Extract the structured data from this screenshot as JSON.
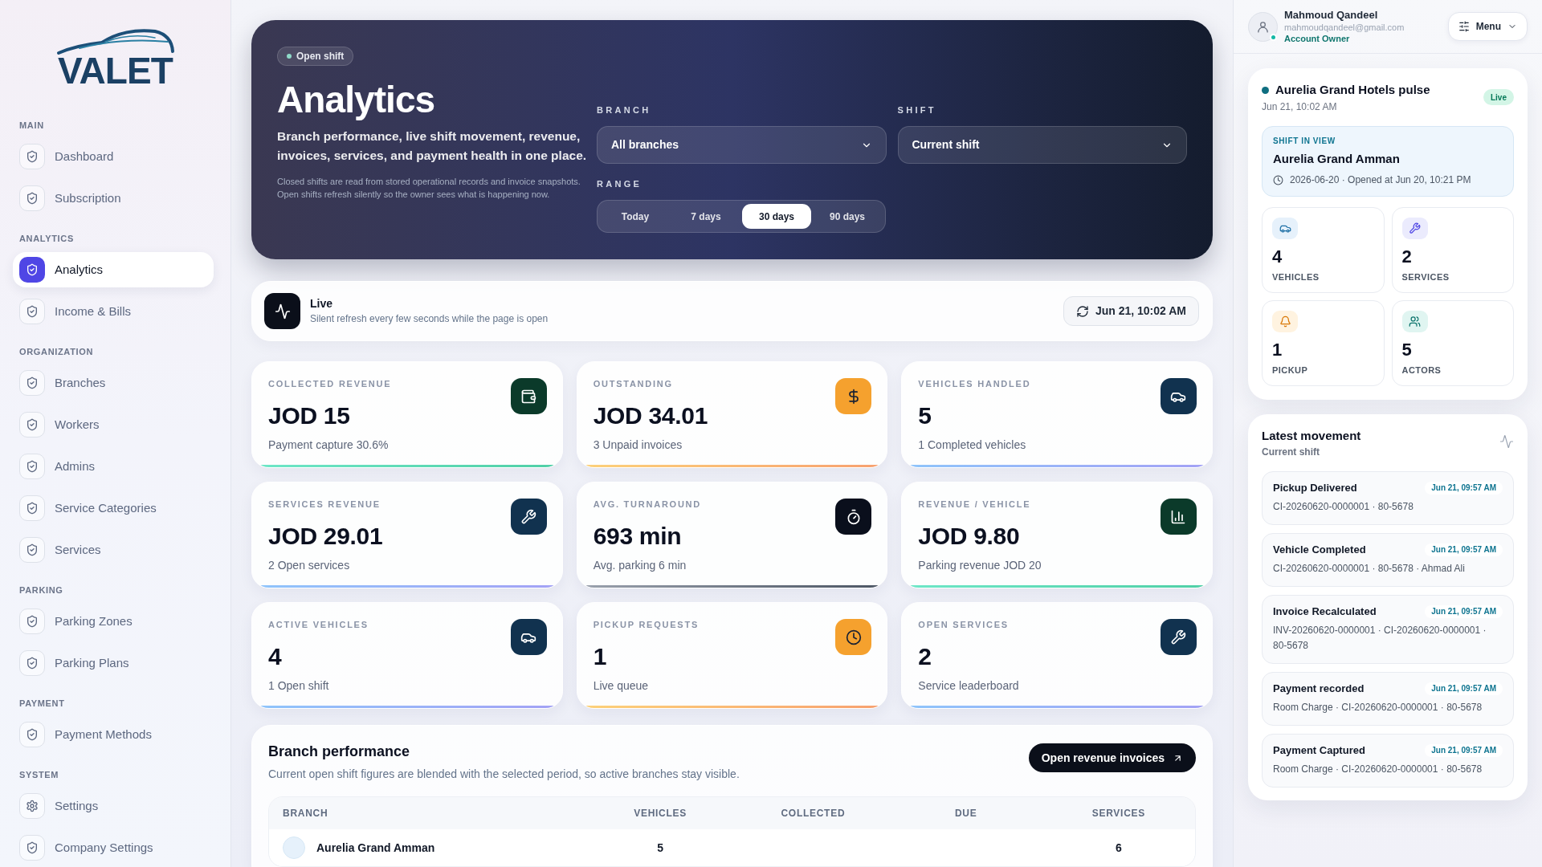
{
  "sidebar": {
    "logo": "VALET",
    "sections": [
      {
        "title": "MAIN",
        "items": [
          {
            "label": "Dashboard",
            "kind": "page",
            "selected": false
          },
          {
            "label": "Subscription",
            "kind": "page",
            "selected": false
          }
        ]
      },
      {
        "title": "ANALYTICS",
        "items": [
          {
            "label": "Analytics",
            "kind": "page",
            "selected": true
          },
          {
            "label": "Income & Bills",
            "kind": "page",
            "selected": false
          }
        ]
      },
      {
        "title": "ORGANIZATION",
        "items": [
          {
            "label": "Branches",
            "kind": "page",
            "selected": false
          },
          {
            "label": "Workers",
            "kind": "page",
            "selected": false
          },
          {
            "label": "Admins",
            "kind": "page",
            "selected": false
          },
          {
            "label": "Service Categories",
            "kind": "page",
            "selected": false
          },
          {
            "label": "Services",
            "kind": "page",
            "selected": false
          }
        ]
      },
      {
        "title": "PARKING",
        "items": [
          {
            "label": "Parking Zones",
            "kind": "page",
            "selected": false
          },
          {
            "label": "Parking Plans",
            "kind": "page",
            "selected": false
          }
        ]
      },
      {
        "title": "PAYMENT",
        "items": [
          {
            "label": "Payment Methods",
            "kind": "page",
            "selected": false
          }
        ]
      },
      {
        "title": "SYSTEM",
        "items": [
          {
            "label": "Settings",
            "kind": "settings",
            "selected": false
          },
          {
            "label": "Company Settings",
            "kind": "page",
            "selected": false
          }
        ]
      }
    ]
  },
  "hero": {
    "badge": "Open shift",
    "title": "Analytics",
    "description": "Branch performance, live shift movement, revenue, invoices, services, and payment health in one place.",
    "note": "Closed shifts are read from stored operational records and invoice snapshots. Open shifts refresh silently so the owner sees what is happening now.",
    "filters": [
      {
        "label": "BRANCH",
        "value": "All branches"
      },
      {
        "label": "SHIFT",
        "value": "Current shift"
      }
    ],
    "range": {
      "label": "RANGE",
      "options": [
        {
          "label": "Today",
          "selected": false
        },
        {
          "label": "7 days",
          "selected": false
        },
        {
          "label": "30 days",
          "selected": true
        },
        {
          "label": "90 days",
          "selected": false
        }
      ]
    }
  },
  "live": {
    "title": "Live",
    "subtitle": "Silent refresh every few seconds while the page is open",
    "updated": "Jun 21, 10:02 AM"
  },
  "stats": [
    {
      "kind": "revenue",
      "label": "COLLECTED REVENUE",
      "value": "JOD 15",
      "note": "Payment capture 30.6%",
      "color": "#0b3a2a"
    },
    {
      "kind": "due",
      "label": "OUTSTANDING",
      "value": "JOD 34.01",
      "note": "3 Unpaid invoices",
      "color": "#f5a12e"
    },
    {
      "kind": "vehicles",
      "label": "VEHICLES HANDLED",
      "value": "5",
      "note": "1 Completed vehicles",
      "color": "#11324f"
    },
    {
      "kind": "services",
      "label": "SERVICES REVENUE",
      "value": "JOD 29.01",
      "note": "2 Open services",
      "color": "#11324f"
    },
    {
      "kind": "time",
      "label": "AVG. TURNAROUND",
      "value": "693 min",
      "note": "Avg. parking 6 min",
      "color": "#0a0f1c"
    },
    {
      "kind": "ratio",
      "label": "REVENUE / VEHICLE",
      "value": "JOD 9.80",
      "note": "Parking revenue JOD 20",
      "color": "#0b3a2a"
    }
  ],
  "live_stats": [
    {
      "kind": "vehicles",
      "label": "ACTIVE VEHICLES",
      "value": "4",
      "note": "1 Open shift",
      "color": "#11324f"
    },
    {
      "kind": "pickup",
      "label": "PICKUP REQUESTS",
      "value": "1",
      "note": "Live queue",
      "color": "#f5a12e"
    },
    {
      "kind": "services",
      "label": "OPEN SERVICES",
      "value": "2",
      "note": "Service leaderboard",
      "color": "#11324f"
    }
  ],
  "branch_performance": {
    "title": "Branch performance",
    "subtitle": "Current open shift figures are blended with the selected period, so active branches stay visible.",
    "button": "Open revenue invoices",
    "table": {
      "columns": [
        "BRANCH",
        "VEHICLES",
        "COLLECTED",
        "DUE",
        "SERVICES"
      ],
      "rows": [
        {
          "branch": "Aurelia Grand Amman",
          "vehicles": "5",
          "services": "6"
        }
      ]
    }
  },
  "user": {
    "name": "Mahmoud Qandeel",
    "email": "mahmoudqandeel@gmail.com",
    "role": "Account Owner",
    "online": true
  },
  "menu": {
    "label": "Menu"
  },
  "pulse": {
    "title": "Aurelia Grand Hotels pulse",
    "time": "Jun 21, 10:02 AM",
    "badge": "Live",
    "shift": {
      "label": "SHIFT IN VIEW",
      "name": "Aurelia Grand Amman",
      "detail": "2026-06-20 · Opened at Jun 20, 10:21 PM"
    },
    "metrics": [
      {
        "kind": "vehicles",
        "value": "4",
        "label": "VEHICLES"
      },
      {
        "kind": "services",
        "value": "2",
        "label": "SERVICES"
      },
      {
        "kind": "pickup",
        "value": "1",
        "label": "PICKUP"
      },
      {
        "kind": "actors",
        "value": "5",
        "label": "ACTORS"
      }
    ]
  },
  "movement": {
    "title": "Latest movement",
    "subtitle": "Current shift",
    "events": [
      {
        "title": "Pickup Delivered",
        "time": "Jun 21, 09:57 AM",
        "detail": "CI-20260620-0000001 · 80-5678"
      },
      {
        "title": "Vehicle Completed",
        "time": "Jun 21, 09:57 AM",
        "detail": "CI-20260620-0000001 · 80-5678 · Ahmad Ali"
      },
      {
        "title": "Invoice Recalculated",
        "time": "Jun 21, 09:57 AM",
        "detail": "INV-20260620-0000001 · CI-20260620-0000001 · 80-5678"
      },
      {
        "title": "Payment recorded",
        "time": "Jun 21, 09:57 AM",
        "detail": "Room Charge · CI-20260620-0000001 · 80-5678"
      },
      {
        "title": "Payment Captured",
        "time": "Jun 21, 09:57 AM",
        "detail": "Room Charge · CI-20260620-0000001 · 80-5678"
      }
    ]
  }
}
